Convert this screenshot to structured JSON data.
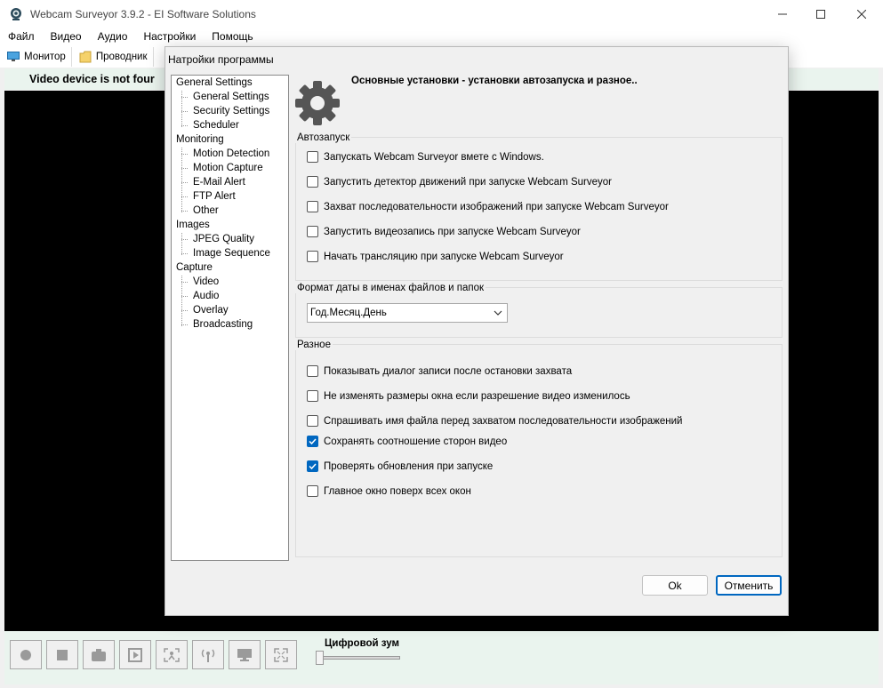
{
  "window": {
    "title": "Webcam Surveyor 3.9.2 - EI Software Solutions",
    "min": "—",
    "max": "☐",
    "close": "✕"
  },
  "menu": [
    "Файл",
    "Видео",
    "Аудио",
    "Настройки",
    "Помощь"
  ],
  "toolbar": {
    "monitor": "Монитор",
    "explorer": "Проводник"
  },
  "status": {
    "text": "Video device is not four"
  },
  "zoom": {
    "label": "Цифровой зум",
    "level": 0
  },
  "dialog": {
    "title": "Натройки программы",
    "header": "Основные установки - установки автозапуска и разное..",
    "tree": [
      {
        "label": "General Settings",
        "children": [
          "General Settings",
          "Security Settings",
          "Scheduler"
        ]
      },
      {
        "label": "Monitoring",
        "children": [
          "Motion Detection",
          "Motion Capture",
          "E-Mail Alert",
          "FTP Alert",
          "Other"
        ]
      },
      {
        "label": "Images",
        "children": [
          "JPEG Quality",
          "Image Sequence"
        ]
      },
      {
        "label": "Capture",
        "children": [
          "Video",
          "Audio",
          "Overlay",
          "Broadcasting"
        ]
      }
    ],
    "autostart": {
      "label": "Автозапуск",
      "items": [
        {
          "text": "Запускать Webcam Surveyor вмете с Windows.",
          "checked": false
        },
        {
          "text": "Запустить детектор движений при запуске Webcam Surveyor",
          "checked": false
        },
        {
          "text": "Захват последовательности изображений при запуске Webcam Surveyor",
          "checked": false
        },
        {
          "text": "Запустить видеозапись при запуске Webcam Surveyor",
          "checked": false
        },
        {
          "text": "Начать трансляцию при запуске Webcam Surveyor",
          "checked": false
        }
      ]
    },
    "date_format": {
      "label": "Формат даты в именах файлов и папок",
      "value": "Год.Месяц.День"
    },
    "misc": {
      "label": "Разное",
      "items": [
        {
          "text": "Показывать диалог записи после остановки захвата",
          "checked": false
        },
        {
          "text": "Не изменять размеры окна если разрешение видео изменилось",
          "checked": false
        },
        {
          "text": "Спрашивать имя файла перед захватом последовательности изображений",
          "checked": false
        },
        {
          "text": "Сохранять соотношение сторон видео",
          "checked": true
        },
        {
          "text": "Проверять обновления при запуске",
          "checked": true
        },
        {
          "text": "Главное окно поверх всех окон",
          "checked": false
        }
      ]
    },
    "ok": "Ok",
    "cancel": "Отменить"
  },
  "colors": {
    "accent": "#0067c0",
    "strip": "#eaf4ee",
    "video": "#000000"
  }
}
